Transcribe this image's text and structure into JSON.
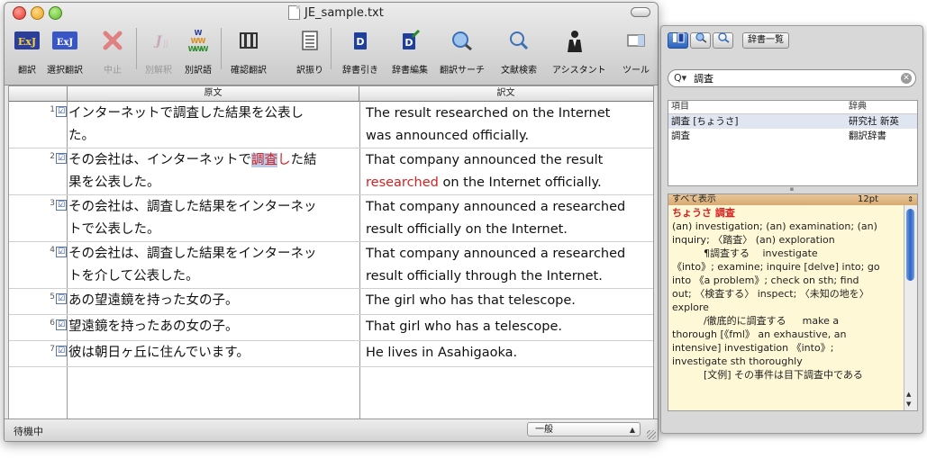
{
  "window": {
    "title": "JE_sample.txt"
  },
  "toolbar": {
    "buttons": [
      {
        "label": "翻訳",
        "icon": "translate-exj-icon",
        "dim": false
      },
      {
        "label": "選択翻訳",
        "icon": "selection-translate-icon",
        "dim": false
      },
      {
        "label": "中止",
        "icon": "stop-x-icon",
        "dim": true
      },
      {
        "label": "別解釈",
        "icon": "alternate-interpretation-icon",
        "dim": true
      },
      {
        "label": "別訳語",
        "icon": "alternate-translation-icon",
        "dim": false
      },
      {
        "label": "確認翻訳",
        "icon": "confirm-translate-icon",
        "dim": false
      },
      {
        "label": "訳振り",
        "icon": "interlinear-icon",
        "dim": false
      },
      {
        "label": "辞書引き",
        "icon": "dictionary-lookup-icon",
        "dim": false
      },
      {
        "label": "辞書編集",
        "icon": "dictionary-edit-icon",
        "dim": false
      },
      {
        "label": "翻訳サーチ",
        "icon": "translation-search-icon",
        "dim": false
      },
      {
        "label": "文献検索",
        "icon": "document-search-icon",
        "dim": false
      },
      {
        "label": "アシスタント",
        "icon": "assistant-icon",
        "dim": false
      },
      {
        "label": "ツール",
        "icon": "tools-icon",
        "dim": false
      }
    ]
  },
  "table": {
    "headers": {
      "source": "原文",
      "target": "訳文"
    },
    "rows": [
      {
        "num": "1",
        "src_lines": [
          "インターネットで調査した結果を公表し",
          "た。"
        ],
        "dst_lines": [
          "The result researched on the Internet",
          "was announced officially."
        ]
      },
      {
        "num": "2",
        "src_pre": "その会社は、インターネットで",
        "src_sel": "調査",
        "src_red": "し",
        "src_post": "た結",
        "src_line2": "果を公表した。",
        "dst_line1": "That company announced the result",
        "dst_red": "researched",
        "dst_rest": " on the Internet officially."
      },
      {
        "num": "3",
        "src_lines": [
          "その会社は、調査した結果をインターネッ",
          "トで公表した。"
        ],
        "dst_lines": [
          "That company announced a researched",
          "result officially on the Internet."
        ]
      },
      {
        "num": "4",
        "src_lines": [
          "その会社は、調査した結果をインターネッ",
          "トを介して公表した。"
        ],
        "dst_lines": [
          "That company announced a researched",
          "result officially through the Internet."
        ]
      },
      {
        "num": "5",
        "src_lines": [
          "あの望遠鏡を持った女の子。"
        ],
        "dst_lines": [
          "The girl who has that telescope."
        ]
      },
      {
        "num": "6",
        "src_lines": [
          "望遠鏡を持ったあの女の子。"
        ],
        "dst_lines": [
          "That girl who has a telescope."
        ]
      },
      {
        "num": "7",
        "src_lines": [
          "彼は朝日ヶ丘に住んでいます。"
        ],
        "dst_lines": [
          "He lives in Asahigaoka."
        ]
      }
    ],
    "check_mark": "☑"
  },
  "status": {
    "text": "待機中",
    "mode": "一般"
  },
  "dictionary": {
    "list_button": "辞書一覧",
    "search_value": "調査",
    "columns": {
      "item": "項目",
      "dict": "辞典"
    },
    "results": [
      {
        "item": "調査 [ちょうさ]",
        "dict": "研究社 新英"
      },
      {
        "item": "調査",
        "dict": "翻訳辞書"
      }
    ],
    "entry_header": {
      "show_all": "すべて表示",
      "size": "12pt"
    },
    "entry_title": "ちょうさ 調査",
    "entry_lines": [
      "(an) investigation; (an) examination; (an)",
      "inquiry; 〈踏査〉 (an) exploration",
      "          ¶調査する　 investigate",
      "《into》; examine; inquire [delve] into; go",
      "into 《a problem》; check on sth; find",
      "out; 〈検査する〉 inspect; 〈未知の地を〉",
      "explore",
      "          /徹底的に調査する　  make a",
      "thorough [《fml》 an exhaustive, an",
      "intensive] investigation 《into》;",
      "investigate sth thoroughly",
      "          [文例] その事件は目下調査中である"
    ]
  }
}
